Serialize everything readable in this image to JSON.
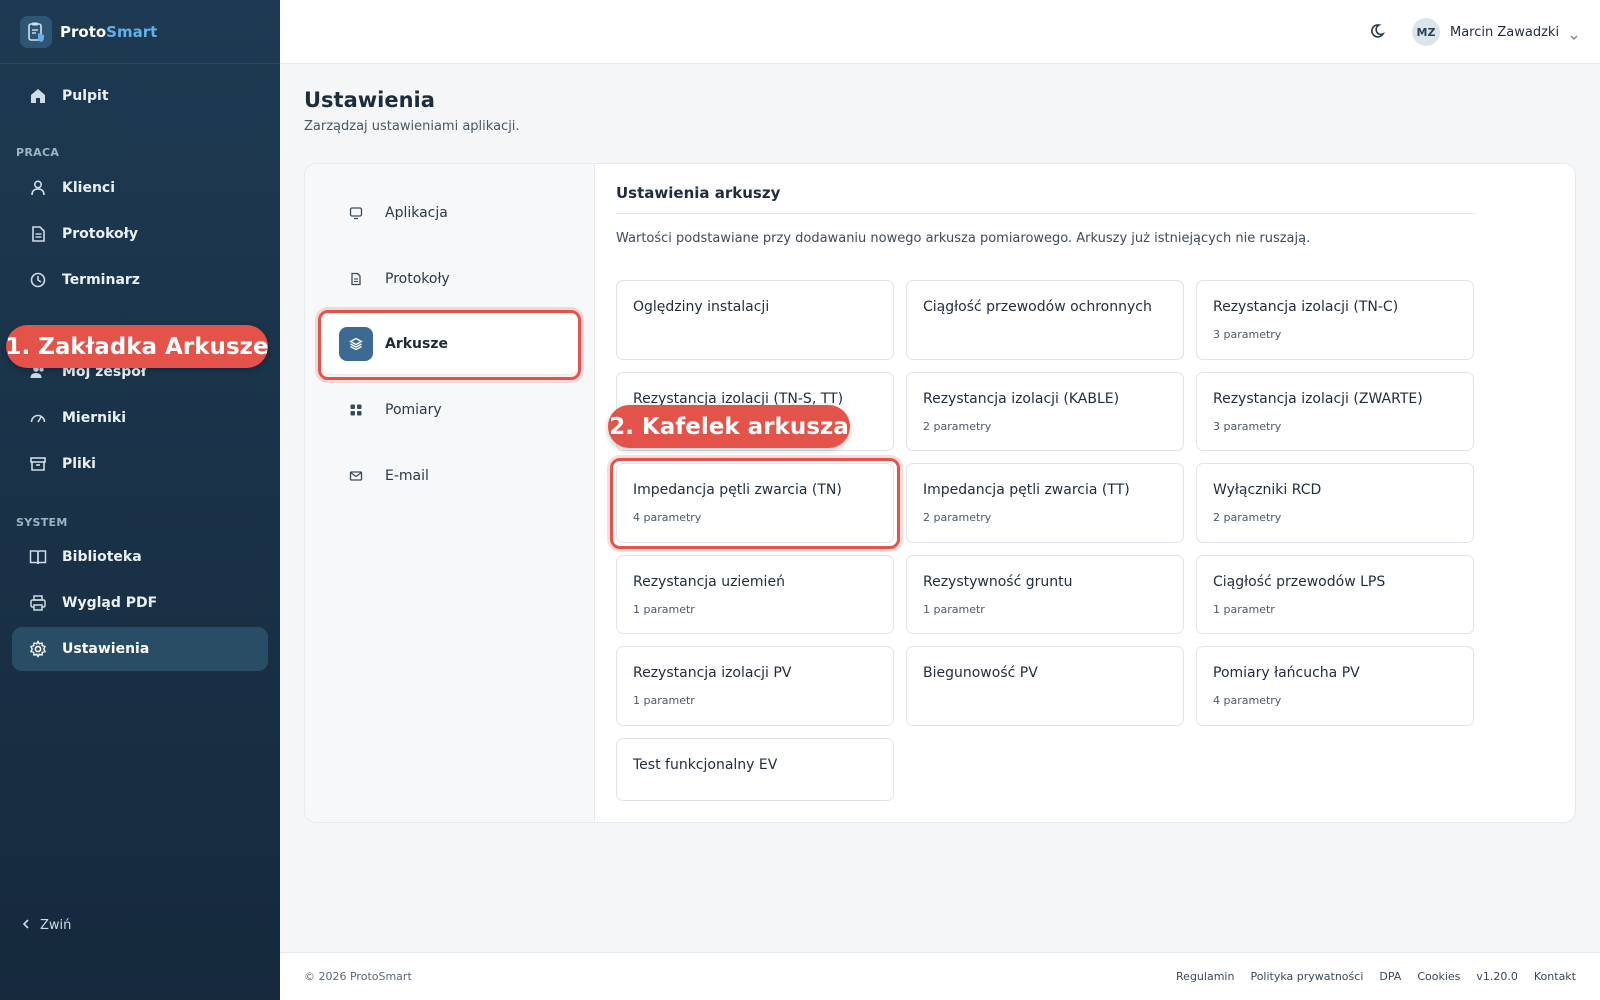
{
  "brand": {
    "name_part1": "Proto",
    "name_part2": "Smart"
  },
  "sidebar": {
    "dashboard": "Pulpit",
    "section_work": "PRACA",
    "clients": "Klienci",
    "protocols": "Protokoły",
    "schedule": "Terminarz",
    "team": "Mój zespół",
    "meters": "Mierniki",
    "files": "Pliki",
    "section_system": "SYSTEM",
    "library": "Biblioteka",
    "pdf_look": "Wygląd PDF",
    "settings": "Ustawienia",
    "collapse": "Zwiń"
  },
  "header": {
    "user_initials": "MZ",
    "user_name": "Marcin Zawadzki"
  },
  "page": {
    "title": "Ustawienia",
    "subtitle": "Zarządzaj ustawieniami aplikacji."
  },
  "settings_nav": {
    "application": "Aplikacja",
    "protocols": "Protokoły",
    "sheets": "Arkusze",
    "measurements": "Pomiary",
    "email": "E-mail"
  },
  "sheets_section": {
    "title": "Ustawienia arkuszy",
    "description": "Wartości podstawiane przy dodawaniu nowego arkusza pomiarowego. Arkuszy już istniejących nie ruszają.",
    "tiles": [
      {
        "title": "Oględziny instalacji",
        "meta": ""
      },
      {
        "title": "Ciągłość przewodów ochronnych",
        "meta": ""
      },
      {
        "title": "Rezystancja izolacji (TN-C)",
        "meta": "3 parametry"
      },
      {
        "title": "Rezystancja izolacji (TN-S, TT)",
        "meta": ""
      },
      {
        "title": "Rezystancja izolacji (KABLE)",
        "meta": "2 parametry"
      },
      {
        "title": "Rezystancja izolacji (ZWARTE)",
        "meta": "3 parametry"
      },
      {
        "title": "Impedancja pętli zwarcia (TN)",
        "meta": "4 parametry"
      },
      {
        "title": "Impedancja pętli zwarcia (TT)",
        "meta": "2 parametry"
      },
      {
        "title": "Wyłączniki RCD",
        "meta": "2 parametry"
      },
      {
        "title": "Rezystancja uziemień",
        "meta": "1 parametr"
      },
      {
        "title": "Rezystywność gruntu",
        "meta": "1 parametr"
      },
      {
        "title": "Ciągłość przewodów LPS",
        "meta": "1 parametr"
      },
      {
        "title": "Rezystancja izolacji PV",
        "meta": "1 parametr"
      },
      {
        "title": "Biegunowość PV",
        "meta": ""
      },
      {
        "title": "Pomiary łańcucha PV",
        "meta": "4 parametry"
      },
      {
        "title": "Test funkcjonalny EV",
        "meta": ""
      }
    ]
  },
  "annotations": {
    "callout1": "1. Zakładka Arkusze",
    "callout2": "2. Kafelek arkusza"
  },
  "footer": {
    "copyright": "© 2026 ProtoSmart",
    "links": [
      "Regulamin",
      "Polityka prywatności",
      "DPA",
      "Cookies",
      "v1.20.0",
      "Kontakt"
    ]
  },
  "colors": {
    "sidebar_bg": "#1d3a52",
    "active_nav": "#2a4d66",
    "accent": "#3c6a92",
    "annotation_red": "#e4534a",
    "brand_accent": "#64b0ea"
  }
}
